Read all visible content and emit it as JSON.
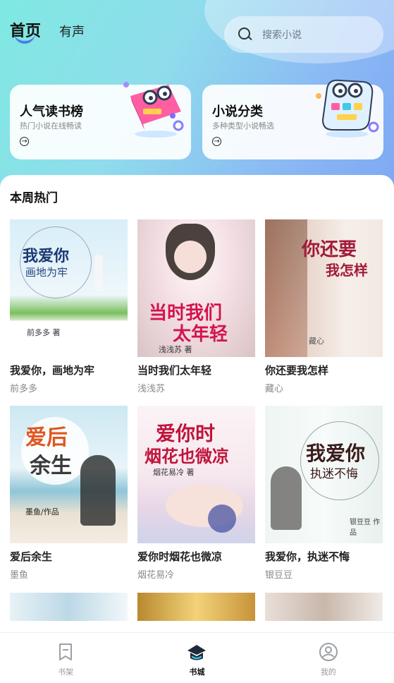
{
  "header": {
    "tabs": [
      {
        "label": "首页"
      },
      {
        "label": "有声"
      }
    ],
    "search": {
      "placeholder": "搜索小说",
      "icon": "search-icon"
    }
  },
  "features": [
    {
      "title": "人气读书榜",
      "subtitle": "热门小说在线畅读",
      "icon": "arrow-right-circle-icon"
    },
    {
      "title": "小说分类",
      "subtitle": "多种类型小说畅选",
      "icon": "arrow-right-circle-icon"
    }
  ],
  "section": {
    "title": "本周热门"
  },
  "books": [
    {
      "title": "我爱你，画地为牢",
      "author": "前多多",
      "cover_text": "我爱你",
      "cover_sub": "画地为牢",
      "cover_author": "前多多 著"
    },
    {
      "title": "当时我们太年轻",
      "author": "浅浅苏",
      "cover_text": "当时我们",
      "cover_sub": "太年轻",
      "cover_author": "浅浅苏 著"
    },
    {
      "title": "你还要我怎样",
      "author": "藏心",
      "cover_text": "你还要",
      "cover_sub": "我怎样",
      "cover_author": "藏心"
    },
    {
      "title": "爱后余生",
      "author": "墨鱼",
      "cover_text": "爱后",
      "cover_sub": "余生",
      "cover_author": "墨鱼/作品"
    },
    {
      "title": "爱你时烟花也微凉",
      "author": "烟花易冷",
      "cover_text": "爱你时",
      "cover_sub": "烟花也微凉",
      "cover_author": "烟花易冷 著"
    },
    {
      "title": "我爱你，执迷不悔",
      "author": "银豆豆",
      "cover_text": "我爱你",
      "cover_sub": "执迷不悔",
      "cover_author": "银豆豆 作品"
    }
  ],
  "nav": [
    {
      "label": "书架",
      "icon": "bookshelf-icon"
    },
    {
      "label": "书城",
      "icon": "bookstore-icon",
      "active": true
    },
    {
      "label": "我的",
      "icon": "profile-icon"
    }
  ],
  "colors": {
    "accent": "#4b7de8",
    "header_start": "#7fe9e1",
    "header_end": "#7fa8f3"
  }
}
